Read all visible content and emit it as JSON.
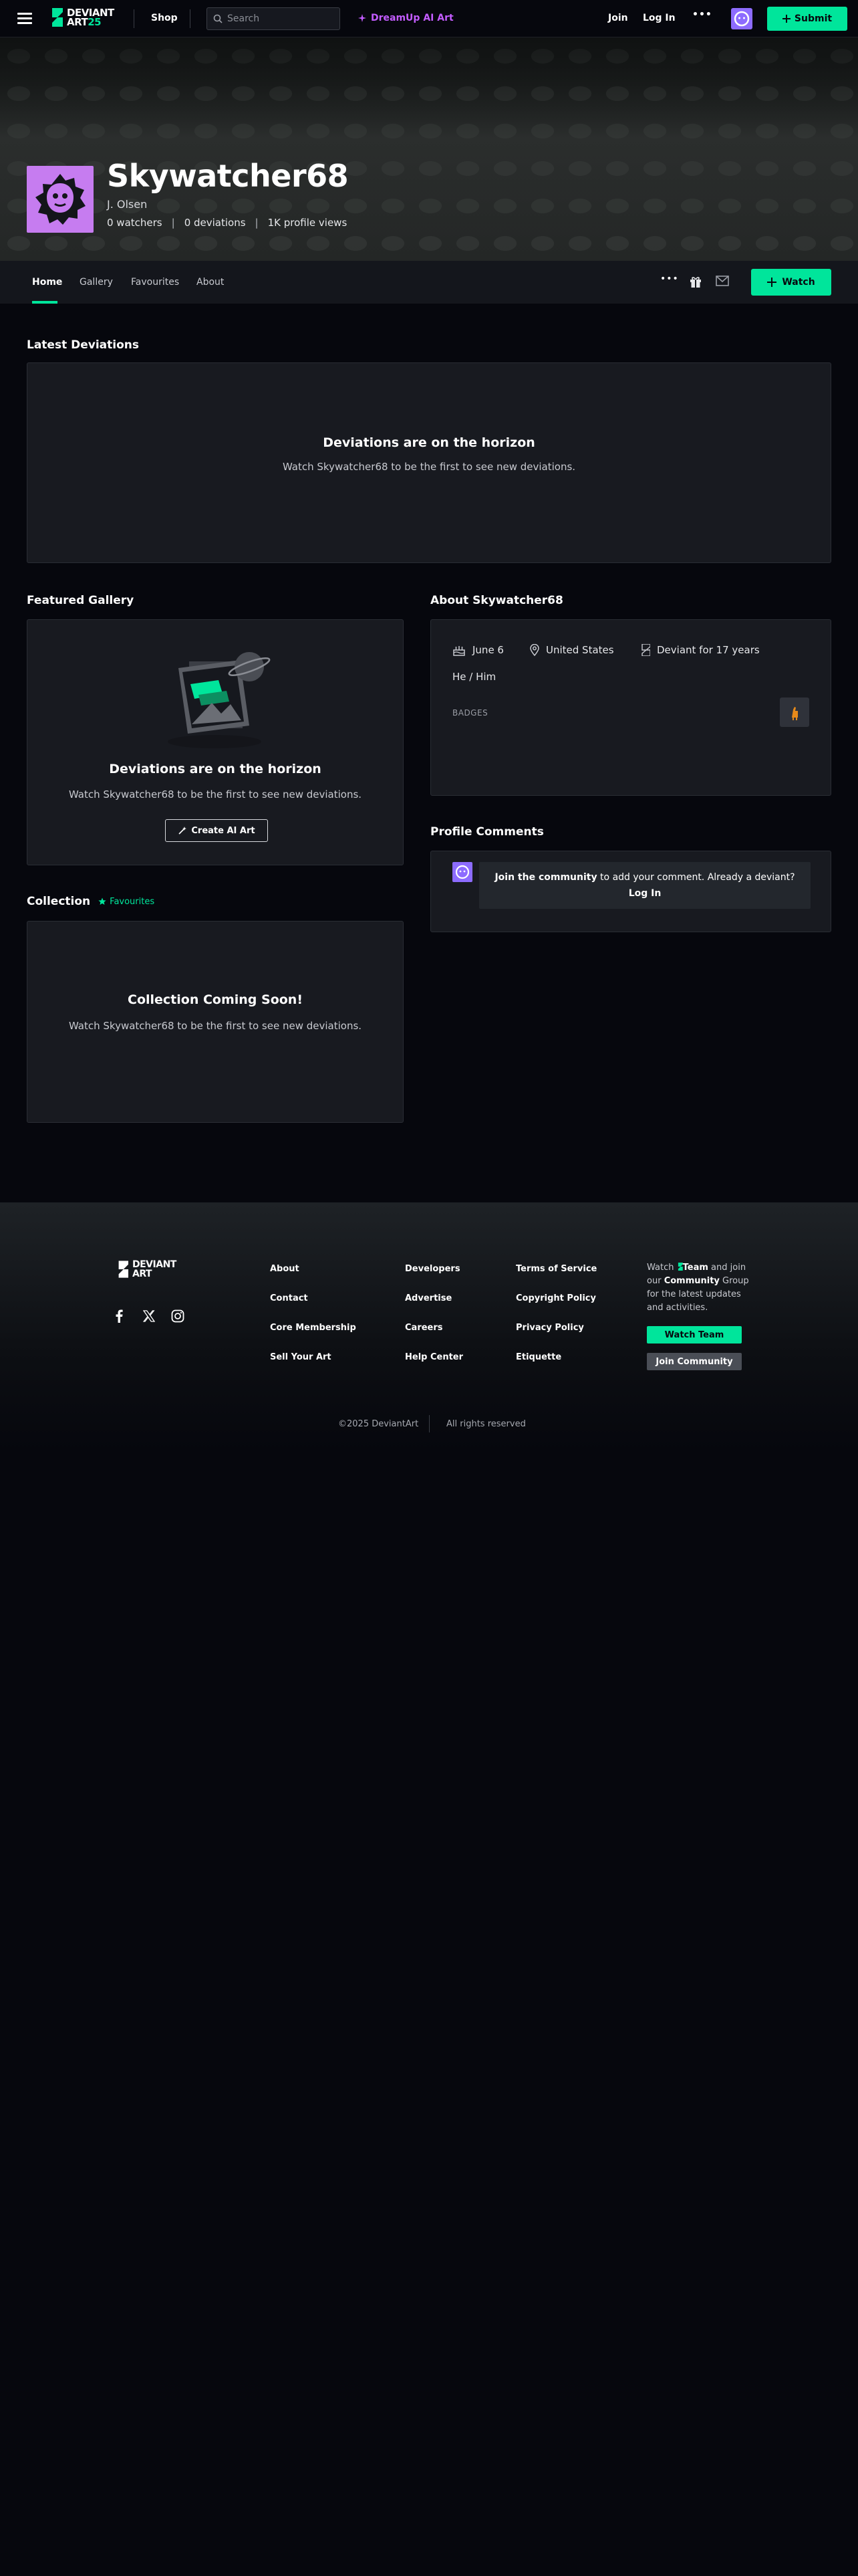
{
  "topnav": {
    "logo_line1": "DEVIANT",
    "logo_line2": "ART",
    "logo_year": "25",
    "shop": "Shop",
    "search_placeholder": "Search",
    "dreamup": "DreamUp AI Art",
    "join": "Join",
    "login": "Log In",
    "more": "•••",
    "submit": "Submit"
  },
  "profile": {
    "username": "Skywatcher68",
    "real_name": "J. Olsen",
    "watchers": "0 watchers",
    "deviations": "0 deviations",
    "views": "1K profile views"
  },
  "tabs": [
    {
      "label": "Home"
    },
    {
      "label": "Gallery"
    },
    {
      "label": "Favourites"
    },
    {
      "label": "About"
    }
  ],
  "tabs_more": "•••",
  "watch_label": "Watch",
  "latest": {
    "title": "Latest Deviations",
    "empty_title": "Deviations are on the horizon",
    "empty_sub": "Watch Skywatcher68 to be the first to see new deviations."
  },
  "featured": {
    "title": "Featured Gallery",
    "empty_title": "Deviations are on the horizon",
    "empty_sub": "Watch Skywatcher68 to be the first to see new deviations.",
    "button": "Create AI Art"
  },
  "collection": {
    "title": "Collection",
    "tag": "Favourites",
    "empty_title": "Collection Coming Soon!",
    "empty_sub": "Watch Skywatcher68 to be the first to see new deviations."
  },
  "about": {
    "title": "About Skywatcher68",
    "birthday": "June 6",
    "location": "United States",
    "member": "Deviant for 17 years",
    "pronouns": "He / Him",
    "badges": "BADGES"
  },
  "comments": {
    "title": "Profile Comments",
    "join_link": "Join the community",
    "mid_text": " to add your comment. Already a deviant? ",
    "login_link": "Log In"
  },
  "footer": {
    "col1": [
      "About",
      "Contact",
      "Core Membership",
      "Sell Your Art"
    ],
    "col2": [
      "Developers",
      "Advertise",
      "Careers",
      "Help Center"
    ],
    "col3": [
      "Terms of Service",
      "Copyright Policy",
      "Privacy Policy",
      "Etiquette"
    ],
    "blurb_watch": "Watch",
    "blurb_team": "Team",
    "blurb_and": "and join our",
    "blurb_community": "Community",
    "blurb_rest": "Group for the latest updates and activities.",
    "watch_team": "Watch Team",
    "join_community": "Join Community",
    "copyright": "©2025 DeviantArt",
    "rights": "All rights reserved"
  },
  "colors": {
    "accent": "#00e59b",
    "dreamup": "#c35cff",
    "avatar": "#c67cf0"
  }
}
